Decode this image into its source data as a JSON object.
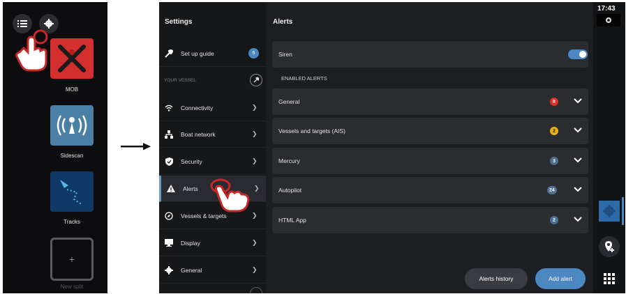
{
  "home": {
    "tiles": [
      {
        "label": "MOB",
        "icon": "mob-icon",
        "color": "#d32f2f"
      },
      {
        "label": "Sidescan",
        "icon": "sidescan-icon",
        "color": "#4a7fa6"
      },
      {
        "label": "Tracks",
        "icon": "tracks-icon",
        "color": "#0f3a66"
      }
    ],
    "new_split_label": "New split",
    "new_split_plus": "+"
  },
  "settings": {
    "title": "Settings",
    "section_label": "YOUR VESSEL",
    "setup_guide": {
      "label": "Set up guide",
      "badge": "6"
    },
    "items": [
      {
        "label": "Connectivity",
        "icon": "wifi-icon"
      },
      {
        "label": "Boat network",
        "icon": "network-icon"
      },
      {
        "label": "Security",
        "icon": "shield-icon"
      },
      {
        "label": "Alerts",
        "icon": "warning-icon",
        "active": true
      },
      {
        "label": "Vessels & targets",
        "icon": "compass-icon"
      },
      {
        "label": "Display",
        "icon": "display-icon"
      },
      {
        "label": "General",
        "icon": "gear-icon"
      }
    ]
  },
  "alerts": {
    "title": "Alerts",
    "siren_label": "Siren",
    "siren_on": true,
    "enabled_label": "ENABLED ALERTS",
    "rows": [
      {
        "label": "General",
        "count": "8",
        "badge_color": "#e0302a"
      },
      {
        "label": "Vessels and targets (AIS)",
        "count": "2",
        "badge_color": "#e7b21a"
      },
      {
        "label": "Mercury",
        "count": "3",
        "badge_color": "#4b6f92"
      },
      {
        "label": "Autopilot",
        "count": "24",
        "badge_color": "#4b6f92"
      },
      {
        "label": "HTML App",
        "count": "2",
        "badge_color": "#4b6f92"
      }
    ],
    "history_button": "Alerts history",
    "add_button": "Add alert"
  },
  "status": {
    "time": "17:43"
  },
  "colors": {
    "accent": "#4b88c2",
    "hand_outline": "#c62828"
  }
}
